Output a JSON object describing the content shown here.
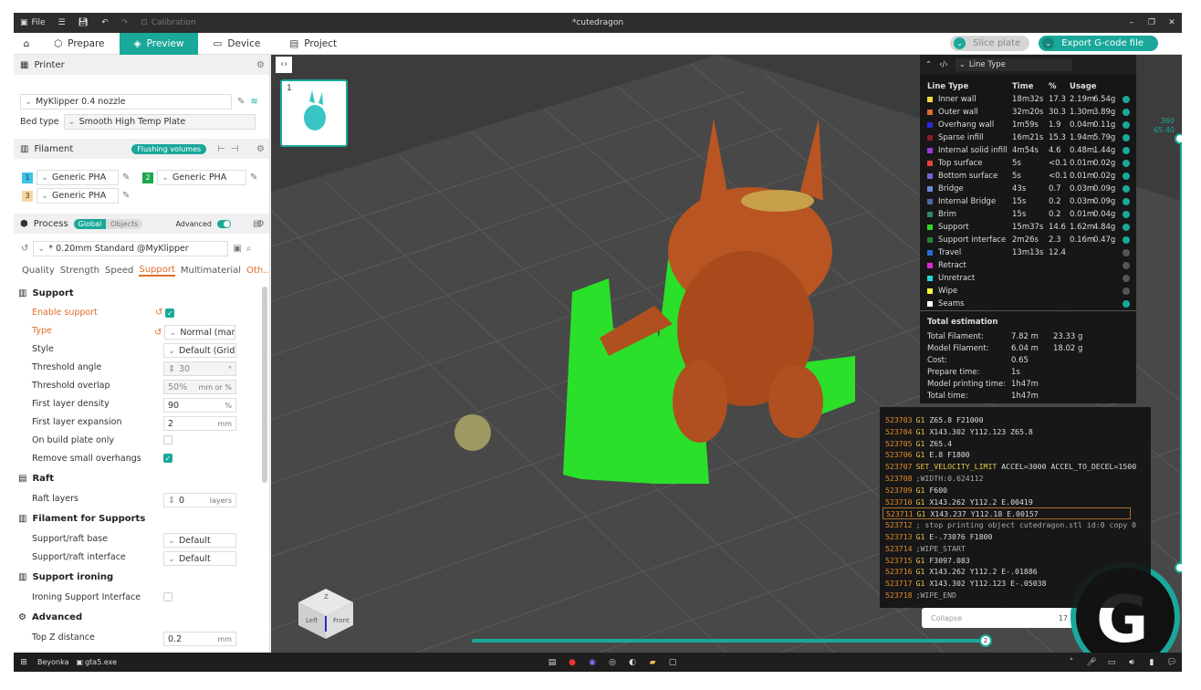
{
  "titlebar": {
    "file": "File",
    "calibration": "Calibration",
    "title": "*cutedragon"
  },
  "nav": {
    "tabs": [
      "Prepare",
      "Preview",
      "Device",
      "Project"
    ],
    "active": "Preview",
    "slice": "Slice plate",
    "export": "Export G-code file"
  },
  "printer": {
    "header": "Printer",
    "name": "MyKlipper 0.4 nozzle",
    "bed_label": "Bed type",
    "bed_value": "Smooth High Temp Plate"
  },
  "filament": {
    "header": "Filament",
    "flushing": "Flushing volumes",
    "slots": [
      {
        "num": "1",
        "name": "Generic PHA",
        "color": "#3ac4e8"
      },
      {
        "num": "2",
        "name": "Generic PHA",
        "color": "#1aa84a"
      },
      {
        "num": "3",
        "name": "Generic PHA",
        "color": "#f5d6a0"
      }
    ]
  },
  "process": {
    "header": "Process",
    "global": "Global",
    "objects": "Objects",
    "advanced": "Advanced",
    "preset": "* 0.20mm Standard @MyKlipper",
    "tabs": [
      "Quality",
      "Strength",
      "Speed",
      "Support",
      "Multimaterial",
      "Oth..."
    ],
    "active_tab": "Support"
  },
  "support": {
    "header": "Support",
    "enable": "Enable support",
    "type_label": "Type",
    "type_value": "Normal (man...",
    "style_label": "Style",
    "style_value": "Default (Grid...",
    "threshold_angle": "Threshold angle",
    "threshold_angle_value": "30",
    "threshold_overlap": "Threshold overlap",
    "threshold_overlap_value": "50%",
    "overlap_unit": "mm or %",
    "first_layer_density": "First layer density",
    "first_layer_density_value": "90",
    "first_layer_expansion": "First layer expansion",
    "first_layer_expansion_value": "2",
    "on_build_plate": "On build plate only",
    "remove_small": "Remove small overhangs"
  },
  "raft": {
    "header": "Raft",
    "layers": "Raft layers",
    "layers_value": "0",
    "layers_unit": "layers"
  },
  "filament_supports": {
    "header": "Filament for Supports",
    "base": "Support/raft base",
    "base_value": "Default",
    "interface": "Support/raft interface",
    "interface_value": "Default"
  },
  "ironing": {
    "header": "Support ironing",
    "interface": "Ironing Support Interface"
  },
  "advanced": {
    "header": "Advanced",
    "top_z": "Top Z distance",
    "top_z_value": "0.2",
    "mm": "mm",
    "pct": "%"
  },
  "plate": {
    "number": "1"
  },
  "legend": {
    "dropdown": "Line Type",
    "headers": [
      "Line Type",
      "Time",
      "%",
      "Usage"
    ],
    "rows": [
      {
        "name": "Inner wall",
        "time": "18m32s",
        "pct": "17.3",
        "m": "2.19m",
        "g": "6.54g",
        "color": "#f5d742",
        "eye": true
      },
      {
        "name": "Outer wall",
        "time": "32m20s",
        "pct": "30.3",
        "m": "1.30m",
        "g": "3.89g",
        "color": "#e06d2a",
        "eye": true
      },
      {
        "name": "Overhang wall",
        "time": "1m59s",
        "pct": "1.9",
        "m": "0.04m",
        "g": "0.11g",
        "color": "#2a2ad8",
        "eye": true
      },
      {
        "name": "Sparse infill",
        "time": "16m21s",
        "pct": "15.3",
        "m": "1.94m",
        "g": "5.79g",
        "color": "#8b1a2a",
        "eye": true
      },
      {
        "name": "Internal solid infill",
        "time": "4m54s",
        "pct": "4.6",
        "m": "0.48m",
        "g": "1.44g",
        "color": "#9a3ad8",
        "eye": true
      },
      {
        "name": "Top surface",
        "time": "5s",
        "pct": "<0.1",
        "m": "0.01m",
        "g": "0.02g",
        "color": "#e8403a",
        "eye": true
      },
      {
        "name": "Bottom surface",
        "time": "5s",
        "pct": "<0.1",
        "m": "0.01m",
        "g": "0.02g",
        "color": "#6a6ad8",
        "eye": true
      },
      {
        "name": "Bridge",
        "time": "43s",
        "pct": "0.7",
        "m": "0.03m",
        "g": "0.09g",
        "color": "#6a8ad8",
        "eye": true
      },
      {
        "name": "Internal Bridge",
        "time": "15s",
        "pct": "0.2",
        "m": "0.03m",
        "g": "0.09g",
        "color": "#4a6aa8",
        "eye": true
      },
      {
        "name": "Brim",
        "time": "15s",
        "pct": "0.2",
        "m": "0.01m",
        "g": "0.04g",
        "color": "#2a8a6a",
        "eye": true
      },
      {
        "name": "Support",
        "time": "15m37s",
        "pct": "14.6",
        "m": "1.62m",
        "g": "4.84g",
        "color": "#2ad82a",
        "eye": true
      },
      {
        "name": "Support interface",
        "time": "2m26s",
        "pct": "2.3",
        "m": "0.16m",
        "g": "0.47g",
        "color": "#1a8a2a",
        "eye": true
      },
      {
        "name": "Travel",
        "time": "13m13s",
        "pct": "12.4",
        "m": "",
        "g": "",
        "color": "#2a6ad8",
        "eye": false
      },
      {
        "name": "Retract",
        "time": "",
        "pct": "",
        "m": "",
        "g": "",
        "color": "#d82ad8",
        "eye": false
      },
      {
        "name": "Unretract",
        "time": "",
        "pct": "",
        "m": "",
        "g": "",
        "color": "#2ad8d8",
        "eye": false
      },
      {
        "name": "Wipe",
        "time": "",
        "pct": "",
        "m": "",
        "g": "",
        "color": "#f5f53a",
        "eye": false
      },
      {
        "name": "Seams",
        "time": "",
        "pct": "",
        "m": "",
        "g": "",
        "color": "#ffffff",
        "eye": true
      }
    ],
    "total_header": "Total estimation",
    "totals": [
      {
        "label": "Total Filament:",
        "v1": "7.82 m",
        "v2": "23.33 g"
      },
      {
        "label": "Model Filament:",
        "v1": "6.04 m",
        "v2": "18.02 g"
      },
      {
        "label": "Cost:",
        "v1": "0.65",
        "v2": ""
      },
      {
        "label": "Prepare time:",
        "v1": "1s",
        "v2": ""
      },
      {
        "label": "Model printing time:",
        "v1": "1h47m",
        "v2": ""
      },
      {
        "label": "Total time:",
        "v1": "1h47m",
        "v2": ""
      }
    ]
  },
  "gcode": [
    {
      "n": "523703",
      "cmd": "G1",
      "args": "Z65.8 F21000",
      "comment": false
    },
    {
      "n": "523704",
      "cmd": "G1",
      "args": "X143.302 Y112.123 Z65.8",
      "comment": false
    },
    {
      "n": "523705",
      "cmd": "G1",
      "args": "Z65.4",
      "comment": false
    },
    {
      "n": "523706",
      "cmd": "G1",
      "args": "E.8 F1800",
      "comment": false
    },
    {
      "n": "523707",
      "cmd": "SET_VELOCITY_LIMIT",
      "args": "ACCEL=3000 ACCEL_TO_DECEL=1500",
      "comment": false
    },
    {
      "n": "523708",
      "cmd": "",
      "args": ";WIDTH:0.624112",
      "comment": true
    },
    {
      "n": "523709",
      "cmd": "G1",
      "args": "F600",
      "comment": false
    },
    {
      "n": "523710",
      "cmd": "G1",
      "args": "X143.262 Y112.2 E.00419",
      "comment": false
    },
    {
      "n": "523711",
      "cmd": "G1",
      "args": "X143.237 Y112.18 E.00157",
      "comment": false
    },
    {
      "n": "523712",
      "cmd": "",
      "args": "; stop printing object cutedragon.stl id:0 copy 0",
      "comment": true
    },
    {
      "n": "523713",
      "cmd": "G1",
      "args": "E-.73076 F1800",
      "comment": false
    },
    {
      "n": "523714",
      "cmd": "",
      "args": ";WIPE_START",
      "comment": true
    },
    {
      "n": "523715",
      "cmd": "G1",
      "args": "F3097.083",
      "comment": false
    },
    {
      "n": "523716",
      "cmd": "G1",
      "args": "X143.262 Y112.2 E-.01886",
      "comment": false
    },
    {
      "n": "523717",
      "cmd": "G1",
      "args": "X143.302 Y112.123 E-.05038",
      "comment": false
    },
    {
      "n": "523718",
      "cmd": "",
      "args": ";WIPE_END",
      "comment": true
    }
  ],
  "gcode_highlight_index": 8,
  "slider": {
    "top1": "360",
    "top2": "65.40",
    "bottom": "2"
  },
  "collapse": "Collapse",
  "bottom_num": "17",
  "cube": {
    "left": "Left",
    "front": "Front",
    "z": "Z"
  },
  "taskbar": {
    "app1": "Beyonka",
    "app2": "gta5.exe"
  }
}
